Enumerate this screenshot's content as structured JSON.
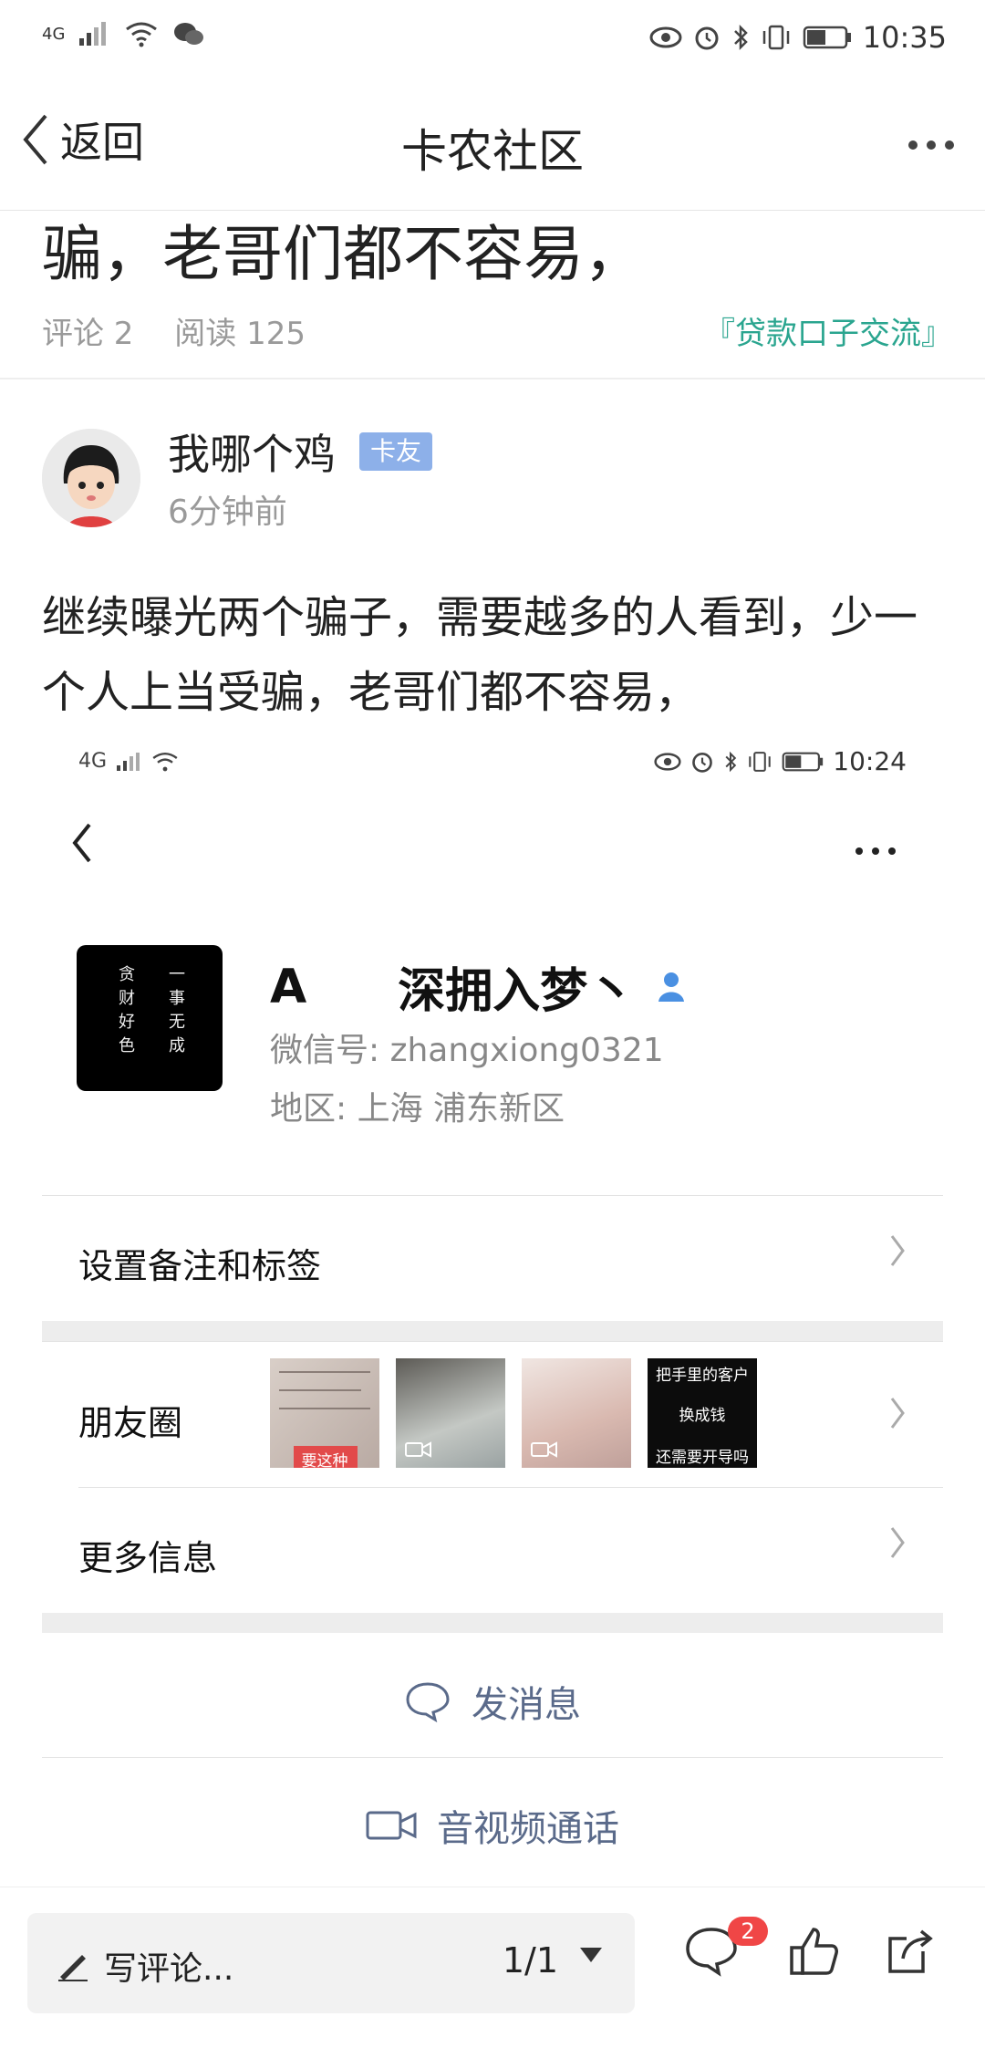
{
  "status_bar": {
    "network": "4G",
    "time": "10:35"
  },
  "nav": {
    "back_label": "返回",
    "title": "卡农社区"
  },
  "article": {
    "headline_fragment": "骗，老哥们都不容易，",
    "comments": "评论 2",
    "reads": "阅读 125",
    "topic": "『贷款口子交流』"
  },
  "author": {
    "name": "我哪个鸡",
    "badge": "卡友",
    "time_ago": "6分钟前"
  },
  "post": {
    "body": "继续曝光两个骗子，需要越多的人看到，少一个人上当受骗，老哥们都不容易，"
  },
  "screenshot": {
    "status_bar": {
      "network": "4G",
      "time": "10:24"
    },
    "profile": {
      "name_part1": "A",
      "name_part2": "深拥入梦丶",
      "wechat_id": "微信号: zhangxiong0321",
      "region": "地区: 上海  浦东新区",
      "avatar_text_right": "一事无成",
      "avatar_text_left": "贪财好色"
    },
    "rows": {
      "remark_label": "设置备注和标签",
      "moments_label": "朋友圈",
      "more_info_label": "更多信息",
      "thumb1_text": "要这种",
      "thumb4_line1": "把手里的客户",
      "thumb4_line2": "换成钱",
      "thumb4_line3": "还需要开导吗"
    },
    "actions": {
      "message": "发消息",
      "call": "音视频通话"
    }
  },
  "bottom_bar": {
    "comment_placeholder": "写评论...",
    "page_indicator": "1/1",
    "comment_count": "2"
  },
  "colors": {
    "topic": "#2aa58f",
    "badge": "#8db0e9",
    "notify": "#f04646"
  }
}
